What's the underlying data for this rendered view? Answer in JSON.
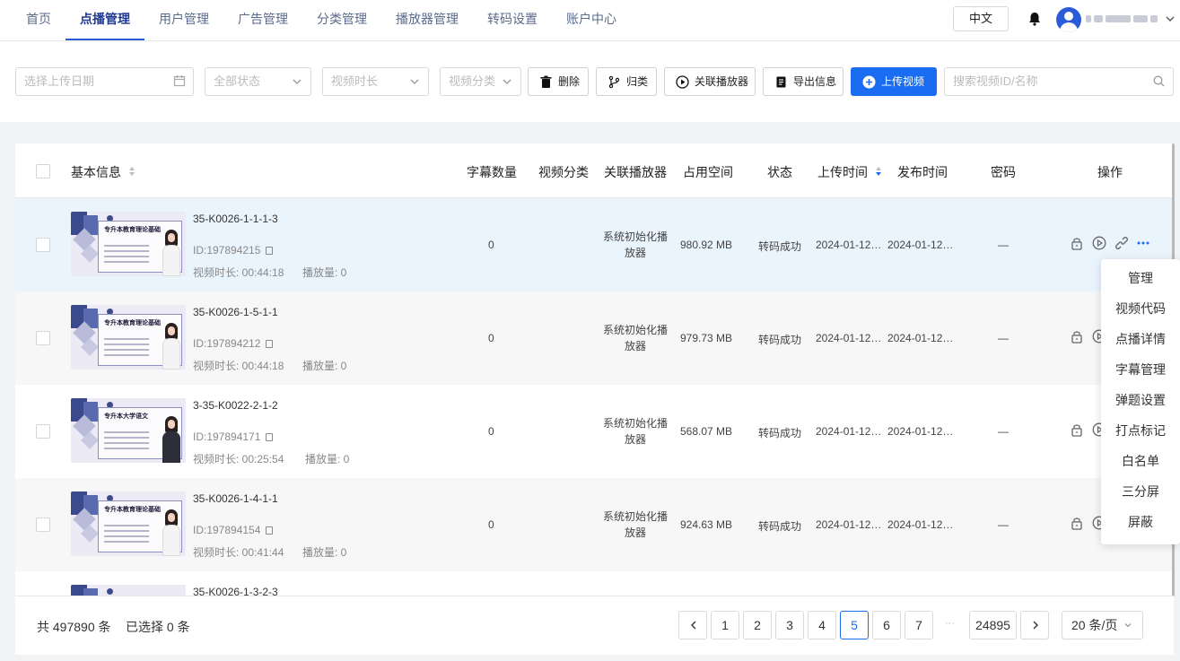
{
  "nav": {
    "items": [
      "首页",
      "点播管理",
      "用户管理",
      "广告管理",
      "分类管理",
      "播放器管理",
      "转码设置",
      "账户中心"
    ],
    "active_index": 1,
    "language": "中文"
  },
  "filters": {
    "date_placeholder": "选择上传日期",
    "status": "全部状态",
    "duration": "视频时长",
    "category": "视频分类",
    "search_placeholder": "搜索视频ID/名称"
  },
  "toolbar": {
    "delete": "删除",
    "categorize": "归类",
    "link_player": "关联播放器",
    "export": "导出信息",
    "upload": "上传视频"
  },
  "table": {
    "headers": {
      "basic": "基本信息",
      "subtitles": "字幕数量",
      "category": "视频分类",
      "player": "关联播放器",
      "space": "占用空间",
      "status": "状态",
      "upload_time": "上传时间",
      "publish_time": "发布时间",
      "password": "密码",
      "actions": "操作"
    },
    "rows": [
      {
        "title": "35-K0026-1-1-1-3",
        "id": "ID:197894215",
        "duration": "视频时长: 00:44:18",
        "plays": "播放量: 0",
        "subtitles": "0",
        "player": "系统初始化播放器",
        "space": "980.92 MB",
        "status": "转码成功",
        "upload": "2024-01-12…",
        "publish": "2024-01-12…",
        "password": "—",
        "thumb_title": "专升本教育理论基础"
      },
      {
        "title": "35-K0026-1-5-1-1",
        "id": "ID:197894212",
        "duration": "视频时长: 00:44:18",
        "plays": "播放量: 0",
        "subtitles": "0",
        "player": "系统初始化播放器",
        "space": "979.73 MB",
        "status": "转码成功",
        "upload": "2024-01-12…",
        "publish": "2024-01-12…",
        "password": "—",
        "thumb_title": "专升本教育理论基础"
      },
      {
        "title": "3-35-K0022-2-1-2",
        "id": "ID:197894171",
        "duration": "视频时长: 00:25:54",
        "plays": "播放量: 0",
        "subtitles": "0",
        "player": "系统初始化播放器",
        "space": "568.07 MB",
        "status": "转码成功",
        "upload": "2024-01-12…",
        "publish": "2024-01-12…",
        "password": "—",
        "thumb_title": "专升本大学语文"
      },
      {
        "title": "35-K0026-1-4-1-1",
        "id": "ID:197894154",
        "duration": "视频时长: 00:41:44",
        "plays": "播放量: 0",
        "subtitles": "0",
        "player": "系统初始化播放器",
        "space": "924.63 MB",
        "status": "转码成功",
        "upload": "2024-01-12…",
        "publish": "2024-01-12…",
        "password": "—",
        "thumb_title": "专升本教育理论基础"
      },
      {
        "title": "35-K0026-1-3-2-3"
      }
    ]
  },
  "dropdown": [
    "管理",
    "视频代码",
    "点播详情",
    "字幕管理",
    "弹题设置",
    "打点标记",
    "白名单",
    "三分屏",
    "屏蔽"
  ],
  "footer": {
    "total": "共 497890 条",
    "selected": "已选择 0 条",
    "pages": [
      "1",
      "2",
      "3",
      "4",
      "5",
      "6",
      "7"
    ],
    "current_page": "5",
    "ellipsis": "···",
    "last_page": "24895",
    "page_size": "20 条/页"
  },
  "colors": {
    "primary": "#1a6cf0",
    "highlight_row": "#eaf4fd"
  }
}
